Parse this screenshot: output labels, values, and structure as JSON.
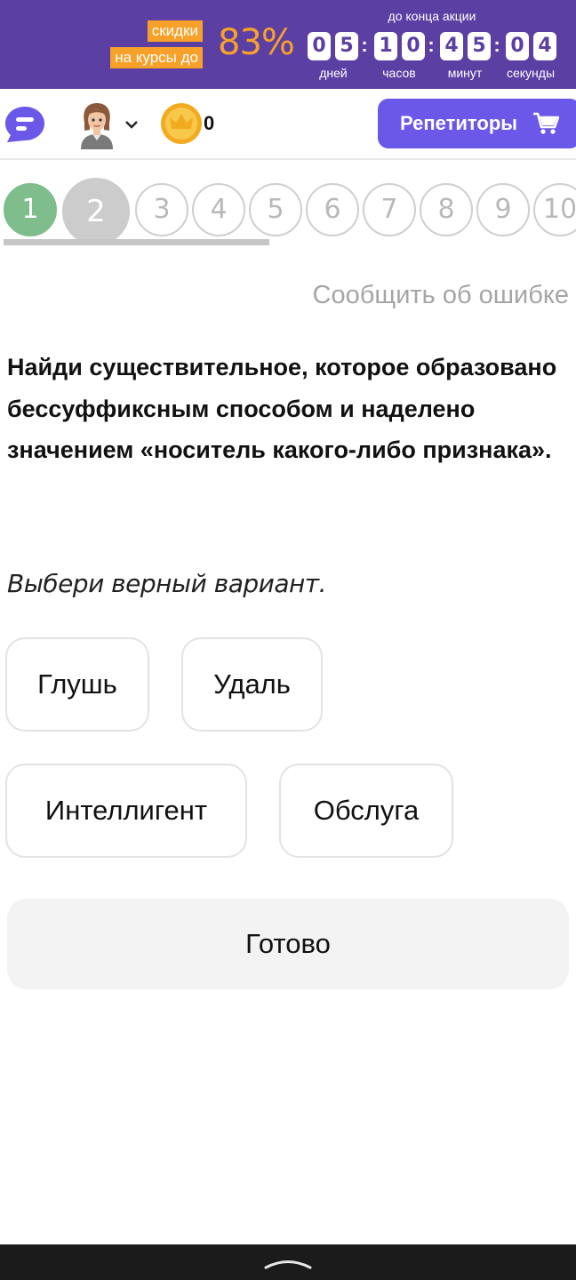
{
  "promo": {
    "tag_line1": "скидки",
    "tag_line2": "на курсы до",
    "percent": "83%",
    "timer_caption": "до конца акции",
    "digits": [
      "0",
      "5",
      "1",
      "0",
      "4",
      "5",
      "0",
      "4"
    ],
    "units": [
      "дней",
      "часов",
      "минут",
      "секунды"
    ]
  },
  "header": {
    "coins": "0",
    "tutors_label": "Репетиторы"
  },
  "steps": {
    "items": [
      "1",
      "2",
      "3",
      "4",
      "5",
      "6",
      "7",
      "8",
      "9",
      "10"
    ],
    "completed": 1,
    "current": 2
  },
  "task": {
    "report_label": "Сообщить об ошибке",
    "question": "Найди существительное, которое образовано бессуффиксным способом и наделено значением «носитель какого-либо признака».",
    "instruction": "Выбери верный вариант.",
    "options": [
      "Глушь",
      "Удаль",
      "Интеллигент",
      "Обслуга"
    ],
    "submit_label": "Готово"
  },
  "colors": {
    "promo_bg": "#5b3fa3",
    "accent_orange": "#f7a12a",
    "tutors_button": "#6b57e8",
    "step_done": "#7fbe8c",
    "step_current": "#cccccc"
  }
}
